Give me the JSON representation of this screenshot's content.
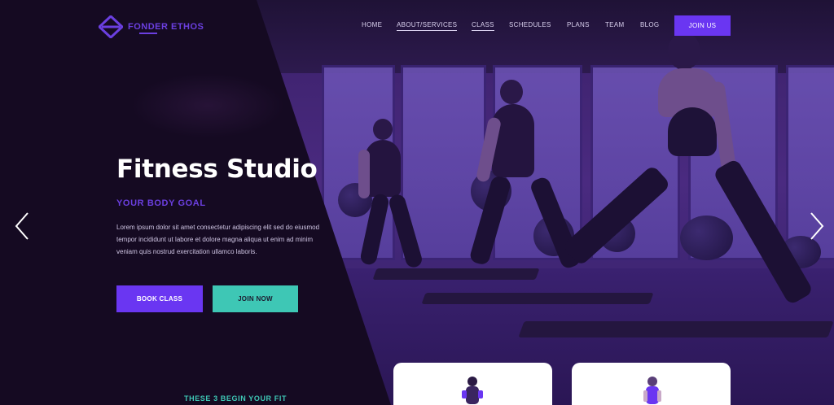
{
  "brand": {
    "name": "FONDER ETHOS",
    "accent": "#6a36f2",
    "teal": "#3ec7b5"
  },
  "nav": {
    "items": [
      {
        "label": "HOME",
        "active": false
      },
      {
        "label": "ABOUT/SERVICES",
        "active": true
      },
      {
        "label": "CLASS",
        "active": true
      },
      {
        "label": "SCHEDULES",
        "active": false
      },
      {
        "label": "PLANS",
        "active": false
      },
      {
        "label": "TEAM",
        "active": false
      },
      {
        "label": "BLOG",
        "active": false
      }
    ],
    "cta_label": "JOIN US"
  },
  "hero": {
    "title": "Fitness Studio",
    "subtitle": "YOUR BODY GOAL",
    "description": "Lorem ipsum dolor sit amet consectetur adipiscing elit sed do eiusmod tempor incididunt ut labore et dolore magna aliqua ut enim ad minim veniam quis nostrud exercitation ullamco laboris.",
    "primary_button": "BOOK CLASS",
    "secondary_button": "JOIN NOW",
    "prev_icon": "chevron-left-icon",
    "next_icon": "chevron-right-icon"
  },
  "bottom": {
    "label": "THESE 3 BEGIN YOUR FIT"
  }
}
